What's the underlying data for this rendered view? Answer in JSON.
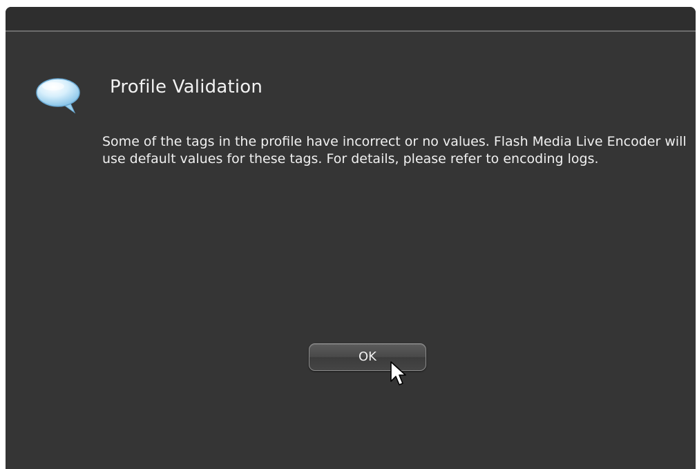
{
  "dialog": {
    "title": "Profile Validation",
    "message": "Some of the tags in the profile have incorrect or no values. Flash Media Live Encoder will use default values for these tags. For details, please refer to encoding logs.",
    "ok_label": "OK",
    "icon": "speech-bubble-icon"
  },
  "colors": {
    "background": "#353535",
    "title_bar": "#2e2e2e",
    "text": "#f0f0f0",
    "bubble": "#bfe3f8"
  }
}
